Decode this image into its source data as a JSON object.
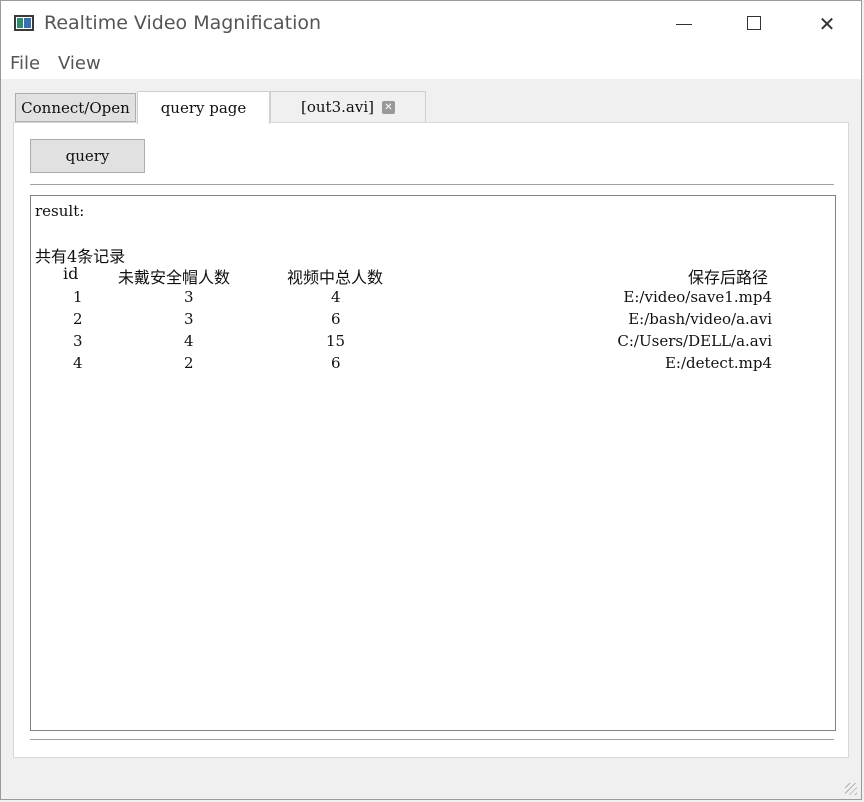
{
  "window": {
    "title": "Realtime Video Magnification",
    "controls": {
      "minimize": "",
      "maximize": "",
      "close": "✕"
    }
  },
  "menu": {
    "file": "File",
    "view": "View"
  },
  "tabs": [
    {
      "label": "Connect/Open"
    },
    {
      "label": "query page"
    },
    {
      "label": "[out3.avi]",
      "close": "✕"
    }
  ],
  "query": {
    "button_label": "query"
  },
  "results": {
    "label": "result:",
    "summary": "共有4条记录",
    "columns": [
      "id",
      "未戴安全帽人数",
      "视频中总人数",
      "保存后路径"
    ],
    "rows": [
      [
        "1",
        "3",
        "4",
        "E:/video/save1.mp4"
      ],
      [
        "2",
        "3",
        "6",
        "E:/bash/video/a.avi"
      ],
      [
        "3",
        "4",
        "15",
        "C:/Users/DELL/a.avi"
      ],
      [
        "4",
        "2",
        "6",
        "E:/detect.mp4"
      ]
    ]
  }
}
